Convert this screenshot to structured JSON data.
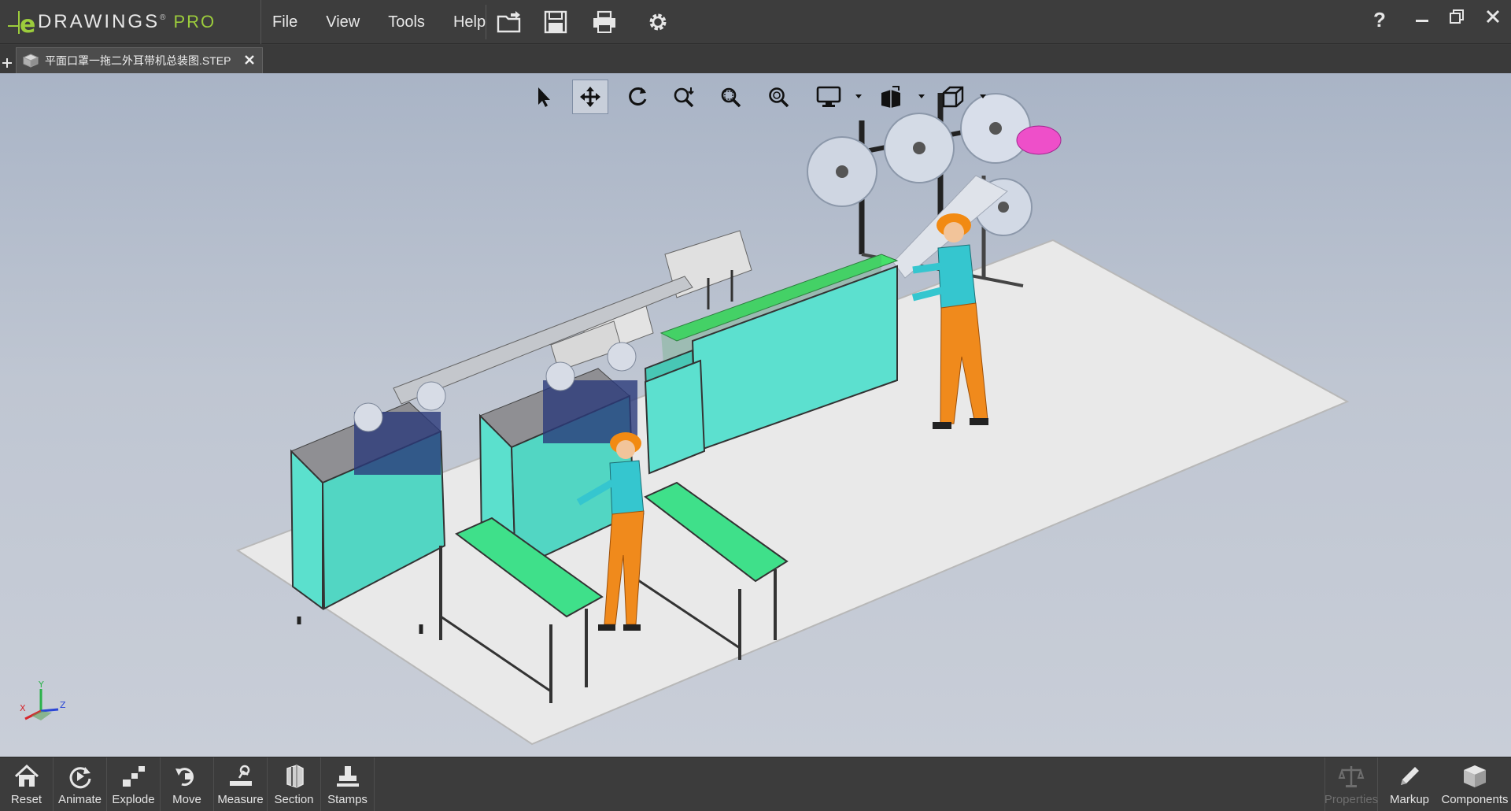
{
  "app": {
    "brand_name": "DRAWINGS",
    "brand_edition": "PRO"
  },
  "menu": [
    {
      "label": "File"
    },
    {
      "label": "View"
    },
    {
      "label": "Tools"
    },
    {
      "label": "Help"
    }
  ],
  "quick_access": [
    "open-icon",
    "save-icon",
    "print-icon",
    "settings-icon"
  ],
  "window_controls": [
    "help-icon",
    "minimize-icon",
    "restore-icon",
    "close-icon"
  ],
  "document_tab": {
    "title": "平面口罩一拖二外耳带机总装图.STEP",
    "icon": "part-icon"
  },
  "view_toolbar": [
    "select",
    "pan",
    "rotate",
    "zoom-to-fit",
    "zoom-to-area",
    "zoom",
    "display-style",
    "view-orientation",
    "standard-views"
  ],
  "active_view_tool": "pan",
  "bottom_toolbar": {
    "left": [
      {
        "label": "Reset",
        "icon": "home-icon"
      },
      {
        "label": "Animate",
        "icon": "animate-icon"
      },
      {
        "label": "Explode",
        "icon": "explode-icon"
      },
      {
        "label": "Move",
        "icon": "move-icon"
      },
      {
        "label": "Measure",
        "icon": "measure-icon"
      },
      {
        "label": "Section",
        "icon": "section-icon"
      },
      {
        "label": "Stamps",
        "icon": "stamps-icon"
      }
    ],
    "right": [
      {
        "label": "Properties",
        "icon": "properties-icon",
        "enabled": false
      },
      {
        "label": "Markup",
        "icon": "markup-icon",
        "enabled": true
      },
      {
        "label": "Components",
        "icon": "components-icon",
        "enabled": true
      }
    ]
  },
  "triad_axes": [
    "X",
    "Y",
    "Z"
  ],
  "colors": {
    "chrome": "#3c3c3c",
    "brand_green": "#9ccc3c",
    "machine_cyan": "#56e3c8",
    "conveyor_green": "#4fe07a",
    "worker_orange": "#f08a1c",
    "worker_shirt": "#36c6d0",
    "floor": "#e8e8e8"
  }
}
